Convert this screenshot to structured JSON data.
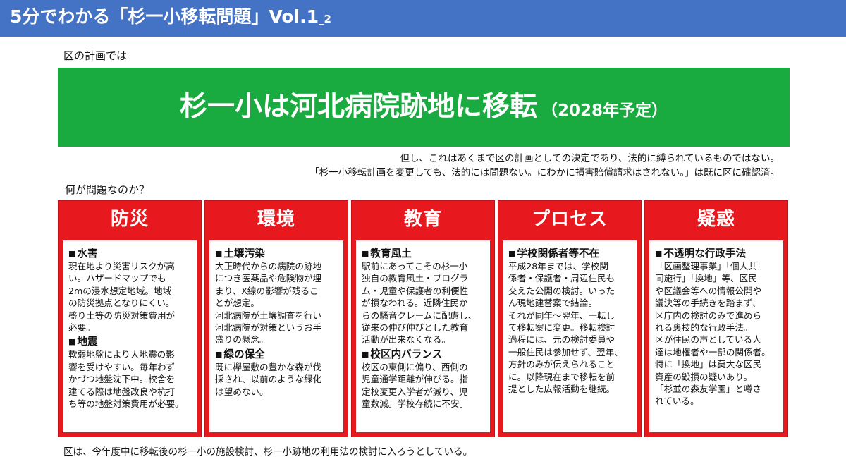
{
  "header": {
    "title": "5分でわかる「杉一小移転問題」Vol.1",
    "subscript": "_2"
  },
  "intro": "区の計画では",
  "banner": {
    "main": "杉一小は河北病院跡地に移転",
    "year": "（2028年予定）"
  },
  "notes": [
    "但し、これはあくまで区の計画としての決定であり、法的に縛られているものではない。",
    "「杉一小移転計画を変更しても、法的には問題ない。にわかに損害賠償請求はされない。」は既に区に確認済。"
  ],
  "question": "何が問題なのか？",
  "columns": [
    {
      "title": "防災",
      "sections": [
        {
          "heading": "水害",
          "text": "現在地より災害リスクが高\nい。ハザードマップでも\n2mの浸水想定地域。地域\nの防災拠点となりにくい。\n盛り土等の防災対策費用が\n必要。"
        },
        {
          "heading": "地震",
          "text": "軟弱地盤により大地震の影\n響を受けやすい。毎年わず\nかづつ地盤沈下中。校舎を\n建てる際は地盤改良や杭打\nち等の地盤対策費用が必要。"
        }
      ]
    },
    {
      "title": "環境",
      "sections": [
        {
          "heading": "土壌汚染",
          "text": "大正時代からの病院の跡地\nにつき医薬品や危険物が埋\nまり、X線の影響が残るこ\nとが想定。\n河北病院が土壌調査を行い\n河北病院が対策というお手\n盛りの懸念。"
        },
        {
          "heading": "緑の保全",
          "text": "既に欅屋敷の豊かな森が伐\n採され、以前のような緑化\nは望めない。"
        }
      ]
    },
    {
      "title": "教育",
      "sections": [
        {
          "heading": "教育風土",
          "text": "駅前にあってこその杉一小\n独自の教育風土・プログラ\nム・児童や保護者の利便性\nが損なわれる。近隣住民か\nらの騒音クレームに配慮し、\n従来の伸び伸びとした教育\n活動が出来なくなる。"
        },
        {
          "heading": "校区内バランス",
          "text": "校区の東側に偏り、西側の\n児童通学距離が伸びる。指\n定校変更入学者が減り、児\n童数減。学校存続に不安。"
        }
      ]
    },
    {
      "title": "プロセス",
      "sections": [
        {
          "heading": "学校関係者等不在",
          "text": "平成28年までは、学校関\n係者・保護者・周辺住民も\n交えた公開の検討。いった\nん現地建替案で結論。\nそれが同年～翌年、一転し\nて移転案に変更。移転検討\n過程には、元の検討委員や\n一般住民は参加せず、翌年、\n方針のみが伝えられること\nに。以降現在まで移転を前\n提とした広報活動を継続。"
        }
      ]
    },
    {
      "title": "疑惑",
      "sections": [
        {
          "heading": "不透明な行政手法",
          "text": "「区画整理事業」「個人共\n同施行」「換地」等、区民\nや区議会等への情報公開や\n議決等の手続きを踏まず、\n区庁内の検討のみで進めら\nれる裏技的な行政手法。\n区が住民の声としている人\n達は地権者や一部の関係者。\n特に「換地」は莫大な区民\n資産の毀損の疑いあり。\n「杉並の森友学園」と噂さ\nれている。"
        }
      ]
    }
  ],
  "footer": "区は、今年度中に移転後の杉一小の施設検討、杉一小跡地の利用法の検討に入ろうとしている。",
  "colors": {
    "header_bg": "#4472c4",
    "banner_bg": "#1aab40",
    "column_red": "#e8191e"
  }
}
